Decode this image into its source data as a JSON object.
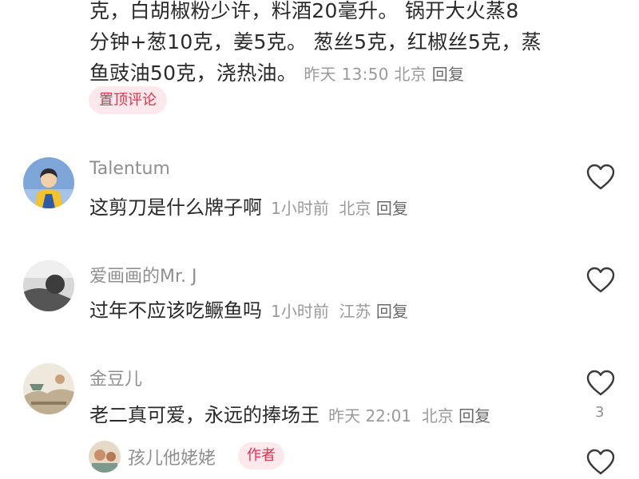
{
  "pinned_comment": {
    "lines": [
      "克，白胡椒粉少许，料酒20毫升。 锅开大火蒸8",
      "分钟+葱10克，姜5克。 葱丝5克，红椒丝5克，蒸",
      "鱼豉油50克，浇热油。"
    ],
    "time": "昨天 13:50",
    "location": "北京",
    "reply_label": "回复",
    "badge": "置顶评论"
  },
  "comments": [
    {
      "username": "Talentum",
      "text": "这剪刀是什么牌子啊",
      "time": "1小时前",
      "location": "北京",
      "reply_label": "回复",
      "likes": ""
    },
    {
      "username": "爱画画的Mr. J",
      "text": "过年不应该吃鳜鱼吗",
      "time": "1小时前",
      "location": "江苏",
      "reply_label": "回复",
      "likes": ""
    },
    {
      "username": "金豆儿",
      "text": "老二真可爱，永远的捧场王",
      "time": "昨天 22:01",
      "location": "北京",
      "reply_label": "回复",
      "likes": "3"
    }
  ],
  "reply": {
    "username": "孩儿他姥姥",
    "author_badge": "作者"
  },
  "colors": {
    "accent": "#e1304f",
    "badge_bg": "#fde9ec",
    "meta_text": "#9a9a9a"
  }
}
